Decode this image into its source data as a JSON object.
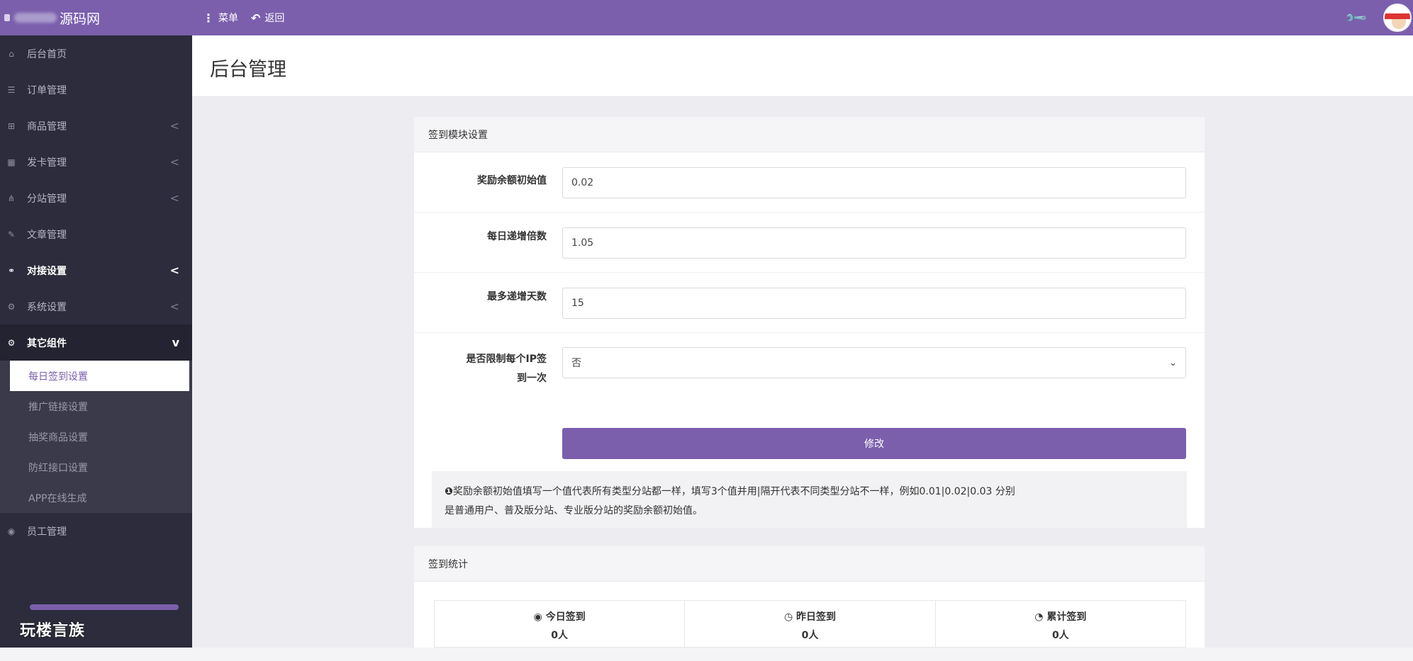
{
  "brand": {
    "name": "源码网"
  },
  "topnav": {
    "menu": "菜单",
    "back": "返回"
  },
  "sidebar": {
    "items": [
      {
        "label": "后台首页",
        "icon": "home-icon"
      },
      {
        "label": "订单管理",
        "icon": "list-icon"
      },
      {
        "label": "商品管理",
        "icon": "cart-icon",
        "chevron": "<"
      },
      {
        "label": "发卡管理",
        "icon": "grid-icon",
        "chevron": "<"
      },
      {
        "label": "分站管理",
        "icon": "sitemap-icon",
        "chevron": "<"
      },
      {
        "label": "文章管理",
        "icon": "edit-icon"
      },
      {
        "label": "对接设置",
        "icon": "link-icon",
        "chevron": "<"
      },
      {
        "label": "系统设置",
        "icon": "gear-icon",
        "chevron": "<"
      },
      {
        "label": "其它组件",
        "icon": "cogs-icon",
        "chevron": "v"
      }
    ],
    "submenu": [
      {
        "label": "每日签到设置"
      },
      {
        "label": "推广链接设置"
      },
      {
        "label": "抽奖商品设置"
      },
      {
        "label": "防红接口设置"
      },
      {
        "label": "APP在线生成"
      }
    ],
    "staff": {
      "label": "员工管理"
    }
  },
  "watermark": {
    "text": "玩楼言族"
  },
  "page": {
    "title": "后台管理"
  },
  "signin_panel": {
    "title": "签到模块设置",
    "fields": [
      {
        "label": "奖励余额初始值",
        "value": "0.02"
      },
      {
        "label": "每日递增倍数",
        "value": "1.05"
      },
      {
        "label": "最多递增天数",
        "value": "15"
      }
    ],
    "ip_limit": {
      "label_line1": "是否限制每个IP签",
      "label_line2": "到一次",
      "value": "否"
    },
    "submit": "修改",
    "note_line1": "奖励余额初始值填写一个值代表所有类型分站都一样，填写3个值并用|隔开代表不同类型分站不一样，例如0.01|0.02|0.03 分别",
    "note_line2": "是普通用户、普及版分站、专业版分站的奖励余额初始值。"
  },
  "stats_panel": {
    "title": "签到统计",
    "stats": [
      {
        "label": "今日签到",
        "value": "0人",
        "icon": "user-circle-icon"
      },
      {
        "label": "昨日签到",
        "value": "0人",
        "icon": "clock-icon"
      },
      {
        "label": "累计签到",
        "value": "0人",
        "icon": "pie-chart-icon"
      }
    ]
  },
  "colors": {
    "accent": "#7b5fad",
    "sidebar_bg": "#2c2c3c",
    "page_bg": "#ededf1"
  }
}
